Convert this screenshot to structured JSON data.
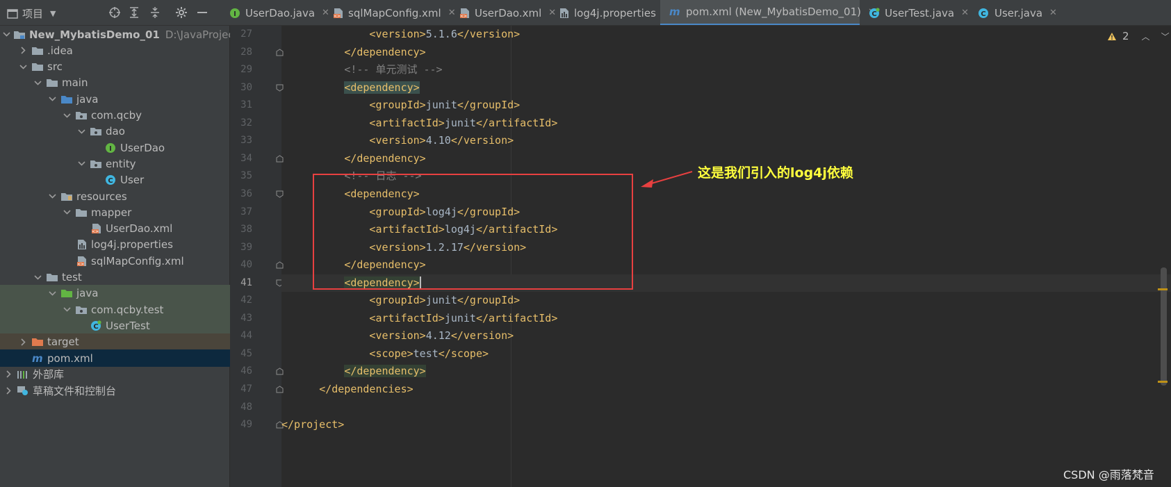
{
  "panel": {
    "title": "项目",
    "toolbar_icons": [
      "crosshair-icon",
      "expand-all-icon",
      "collapse-all-icon",
      "gear-icon",
      "minimize-icon"
    ]
  },
  "tree": [
    {
      "label": "New_MybatisDemo_01",
      "path": "D:\\JavaProjec",
      "depth": 0,
      "arrow": "down",
      "icon": "module-folder-icon",
      "bold": true
    },
    {
      "label": ".idea",
      "depth": 1,
      "arrow": "right",
      "icon": "folder-icon"
    },
    {
      "label": "src",
      "depth": 1,
      "arrow": "down",
      "icon": "folder-icon"
    },
    {
      "label": "main",
      "depth": 2,
      "arrow": "down",
      "icon": "folder-icon"
    },
    {
      "label": "java",
      "depth": 3,
      "arrow": "down",
      "icon": "source-folder-icon"
    },
    {
      "label": "com.qcby",
      "depth": 4,
      "arrow": "down",
      "icon": "package-icon"
    },
    {
      "label": "dao",
      "depth": 5,
      "arrow": "down",
      "icon": "package-icon"
    },
    {
      "label": "UserDao",
      "depth": 6,
      "arrow": "",
      "icon": "interface-icon"
    },
    {
      "label": "entity",
      "depth": 5,
      "arrow": "down",
      "icon": "package-icon"
    },
    {
      "label": "User",
      "depth": 6,
      "arrow": "",
      "icon": "class-icon"
    },
    {
      "label": "resources",
      "depth": 3,
      "arrow": "down",
      "icon": "resources-folder-icon"
    },
    {
      "label": "mapper",
      "depth": 4,
      "arrow": "down",
      "icon": "folder-icon"
    },
    {
      "label": "UserDao.xml",
      "depth": 5,
      "arrow": "",
      "icon": "xml-file-icon"
    },
    {
      "label": "log4j.properties",
      "depth": 4,
      "arrow": "",
      "icon": "properties-file-icon"
    },
    {
      "label": "sqlMapConfig.xml",
      "depth": 4,
      "arrow": "",
      "icon": "xml-file-icon"
    },
    {
      "label": "test",
      "depth": 2,
      "arrow": "down",
      "icon": "folder-icon"
    },
    {
      "label": "java",
      "depth": 3,
      "arrow": "down",
      "icon": "test-source-folder-icon",
      "bg": "test"
    },
    {
      "label": "com.qcby.test",
      "depth": 4,
      "arrow": "down",
      "icon": "package-icon",
      "bg": "test"
    },
    {
      "label": "UserTest",
      "depth": 5,
      "arrow": "",
      "icon": "test-class-icon",
      "bg": "test"
    },
    {
      "label": "target",
      "depth": 1,
      "arrow": "right",
      "icon": "excluded-folder-icon",
      "bg": "target"
    },
    {
      "label": "pom.xml",
      "depth": 1,
      "arrow": "",
      "icon": "maven-icon",
      "bg": "selected"
    },
    {
      "label": "外部库",
      "depth": 0,
      "arrow": "right",
      "icon": "library-icon"
    },
    {
      "label": "草稿文件和控制台",
      "depth": 0,
      "arrow": "right",
      "icon": "scratches-icon"
    }
  ],
  "tabs": [
    {
      "label": "UserDao.java",
      "icon": "interface-icon",
      "active": false
    },
    {
      "label": "sqlMapConfig.xml",
      "icon": "xml-file-icon",
      "active": false
    },
    {
      "label": "UserDao.xml",
      "icon": "xml-file-icon",
      "active": false
    },
    {
      "label": "log4j.properties",
      "icon": "properties-file-icon",
      "active": false
    },
    {
      "label": "pom.xml (New_MybatisDemo_01)",
      "icon": "maven-icon",
      "active": true
    },
    {
      "label": "UserTest.java",
      "icon": "test-class-icon",
      "active": false
    },
    {
      "label": "User.java",
      "icon": "class-icon",
      "active": false
    }
  ],
  "editor": {
    "lines": [
      {
        "n": "27",
        "indent": 3,
        "tag": "version",
        "text": "5.1.6"
      },
      {
        "n": "28",
        "indent": 2,
        "close": "dependency",
        "fold": true
      },
      {
        "n": "29",
        "indent": 2,
        "comment": "<!-- 单元测试 -->"
      },
      {
        "n": "30",
        "indent": 2,
        "open": "dependency",
        "fold": true,
        "hl": true
      },
      {
        "n": "31",
        "indent": 3,
        "tag": "groupId",
        "text": "junit"
      },
      {
        "n": "32",
        "indent": 3,
        "tag": "artifactId",
        "text": "junit"
      },
      {
        "n": "33",
        "indent": 3,
        "tag": "version",
        "text": "4.10"
      },
      {
        "n": "34",
        "indent": 2,
        "close": "dependency",
        "fold": true
      },
      {
        "n": "35",
        "indent": 2,
        "comment": "<!-- 日志 -->"
      },
      {
        "n": "36",
        "indent": 2,
        "open": "dependency",
        "fold": true
      },
      {
        "n": "37",
        "indent": 3,
        "tag": "groupId",
        "text": "log4j"
      },
      {
        "n": "38",
        "indent": 3,
        "tag": "artifactId",
        "text": "log4j"
      },
      {
        "n": "39",
        "indent": 3,
        "tag": "version",
        "text": "1.2.17"
      },
      {
        "n": "40",
        "indent": 2,
        "close": "dependency",
        "fold": true
      },
      {
        "n": "41",
        "indent": 2,
        "open": "dependency",
        "fold": true,
        "current": true,
        "hl2": true,
        "caret": true
      },
      {
        "n": "42",
        "indent": 3,
        "tag": "groupId",
        "text": "junit"
      },
      {
        "n": "43",
        "indent": 3,
        "tag": "artifactId",
        "text": "junit"
      },
      {
        "n": "44",
        "indent": 3,
        "tag": "version",
        "text": "4.12"
      },
      {
        "n": "45",
        "indent": 3,
        "tag": "scope",
        "text": "test"
      },
      {
        "n": "46",
        "indent": 2,
        "close": "dependency",
        "fold": true,
        "hl2": true
      },
      {
        "n": "47",
        "indent": 1,
        "close": "dependencies",
        "fold": true
      },
      {
        "n": "48",
        "indent": 0,
        "blank": true
      },
      {
        "n": "49",
        "indent": 0,
        "close": "project",
        "fold": true
      }
    ]
  },
  "annotation": {
    "text": "这是我们引入的log4j依赖",
    "color": "#ffff3d",
    "box_color": "#e84040"
  },
  "inspection": {
    "warnings": "2",
    "icon": "warning-icon"
  },
  "watermark": "CSDN @雨落梵音",
  "colors": {
    "tag": "#e8bf6a",
    "text": "#a9b7c6",
    "comment": "#808080",
    "accent": "#4a88c7"
  }
}
